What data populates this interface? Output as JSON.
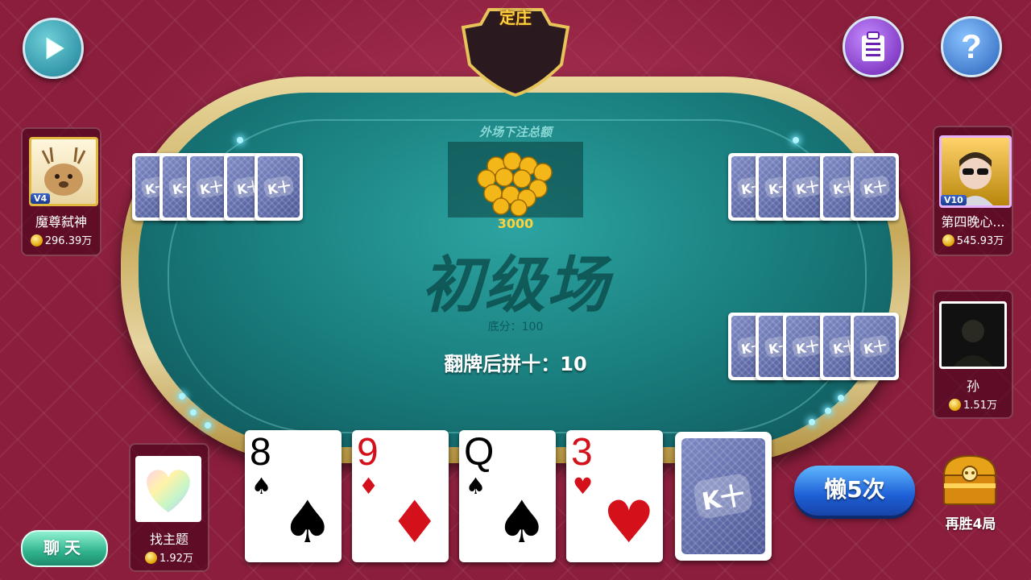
{
  "crest": {
    "label": "定庄"
  },
  "table": {
    "outside_bet_label": "外场下注总额",
    "outside_bet_amount": "3000",
    "room_name": "初级场",
    "base_score": "底分：100",
    "flip_info": "翻牌后拼十：10"
  },
  "players": {
    "top_left": {
      "name": "魔尊弑神",
      "coins": "296.39万",
      "vip": "V4"
    },
    "top_right": {
      "name": "第四晚心...",
      "coins": "545.93万",
      "vip": "V10"
    },
    "right": {
      "name": "孙",
      "coins": "1.51万"
    },
    "self": {
      "name": "找主题",
      "coins": "1.92万"
    }
  },
  "card_back_text": "K十",
  "hand": [
    {
      "rank": "8",
      "suit": "♠",
      "color": "black"
    },
    {
      "rank": "9",
      "suit": "♦",
      "color": "red"
    },
    {
      "rank": "Q",
      "suit": "♠",
      "color": "black"
    },
    {
      "rank": "3",
      "suit": "♥",
      "color": "red"
    }
  ],
  "buttons": {
    "lazy": "懒5次",
    "chat": "聊天",
    "chest_label": "再胜4局"
  }
}
